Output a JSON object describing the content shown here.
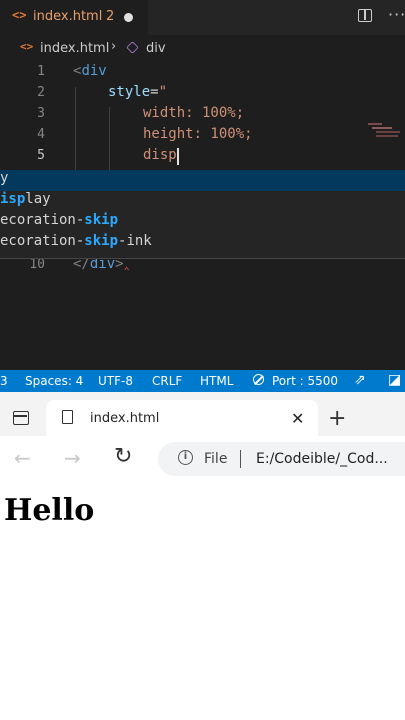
{
  "editor": {
    "tab": {
      "icon": "code-icon",
      "filename": "index.html",
      "problems": "2",
      "modified": true
    },
    "actions": [
      {
        "icon": "split-editor-icon"
      },
      {
        "icon": "more-actions-icon"
      }
    ],
    "breadcrumb": {
      "file": "index.html",
      "symbol": "div"
    },
    "lines": [
      {
        "number": "1",
        "text": "<div"
      },
      {
        "number": "2",
        "text": "style=\""
      },
      {
        "number": "3",
        "text": "width: 100%;"
      },
      {
        "number": "4",
        "text": "height: 100%;"
      },
      {
        "number": "5",
        "text": "disp"
      },
      {
        "number": "10",
        "text": "</div>"
      }
    ],
    "suggestions": [
      {
        "pre": "",
        "hl": "",
        "post": "y",
        "selected": true
      },
      {
        "pre": "",
        "hl": "isp",
        "post": "lay",
        "selected": false
      },
      {
        "pre": "ecoration-",
        "hl": "skip",
        "post": "",
        "selected": false
      },
      {
        "pre": "ecoration-",
        "hl": "skip",
        "post": "-ink",
        "selected": false
      }
    ]
  },
  "statusbar": {
    "problems": "3",
    "spaces": "Spaces: 4",
    "encoding": "UTF-8",
    "eol": "CRLF",
    "language": "HTML",
    "port": "Port : 5500"
  },
  "browser": {
    "tab_title": "index.html",
    "close_glyph": "✕",
    "new_tab_glyph": "+",
    "back_glyph": "←",
    "forward_glyph": "→",
    "reload_glyph": "↻",
    "info_glyph": "i",
    "scheme_label": "File",
    "url": "E:/Codeible/_Cod...",
    "page_heading": "Hello"
  },
  "colors": {
    "statusbar": "#007acc",
    "suggest_selected": "#04395e",
    "tab_filename": "#e8a06a"
  }
}
